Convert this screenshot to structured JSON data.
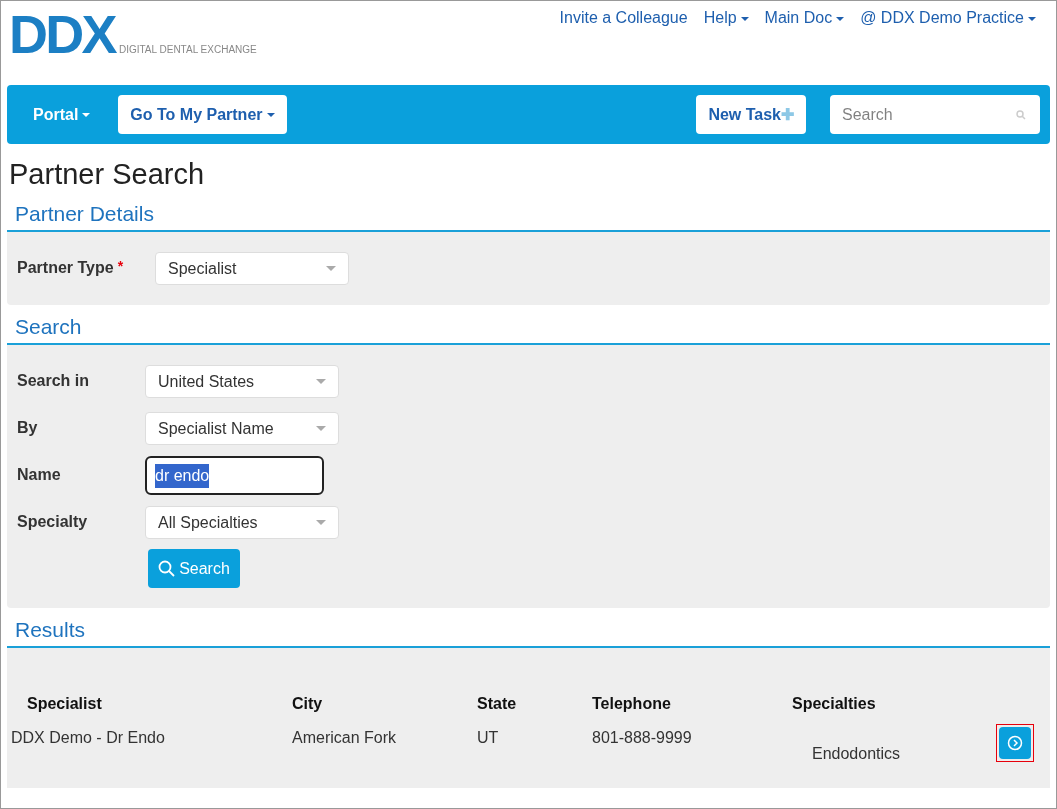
{
  "logo": {
    "letters": "DDX",
    "tagline": "DIGITAL DENTAL EXCHANGE"
  },
  "top_links": [
    {
      "label": "Invite a Colleague",
      "dropdown": false
    },
    {
      "label": "Help",
      "dropdown": true
    },
    {
      "label": "Main Doc",
      "dropdown": true
    },
    {
      "label": "@ DDX Demo Practice",
      "dropdown": true
    }
  ],
  "navbar": {
    "portal": "Portal",
    "partner": "Go To My Partner",
    "new_task": "New Task",
    "new_task_icon": "✚",
    "search": {
      "placeholder": "Search"
    }
  },
  "page_title": "Partner Search",
  "partner_details": {
    "heading": "Partner Details",
    "label": "Partner Type",
    "required_mark": "*",
    "value": "Specialist"
  },
  "search": {
    "heading": "Search",
    "fields": [
      {
        "kind": "select",
        "label": "Search in",
        "value": "United States"
      },
      {
        "kind": "select",
        "label": "By",
        "value": "Specialist Name"
      },
      {
        "kind": "text",
        "label": "Name",
        "value": "dr endo",
        "highlighted": true
      },
      {
        "kind": "select",
        "label": "Specialty",
        "value": "All Specialties"
      }
    ],
    "button": "Search"
  },
  "results": {
    "heading": "Results",
    "columns": [
      "Specialist",
      "City",
      "State",
      "Telephone",
      "Specialties"
    ],
    "rows": [
      {
        "cells": [
          "DDX Demo - Dr Endo",
          "American Fork",
          "UT",
          "801-888-9999",
          "Endodontics"
        ],
        "action_outlined": true
      }
    ]
  }
}
